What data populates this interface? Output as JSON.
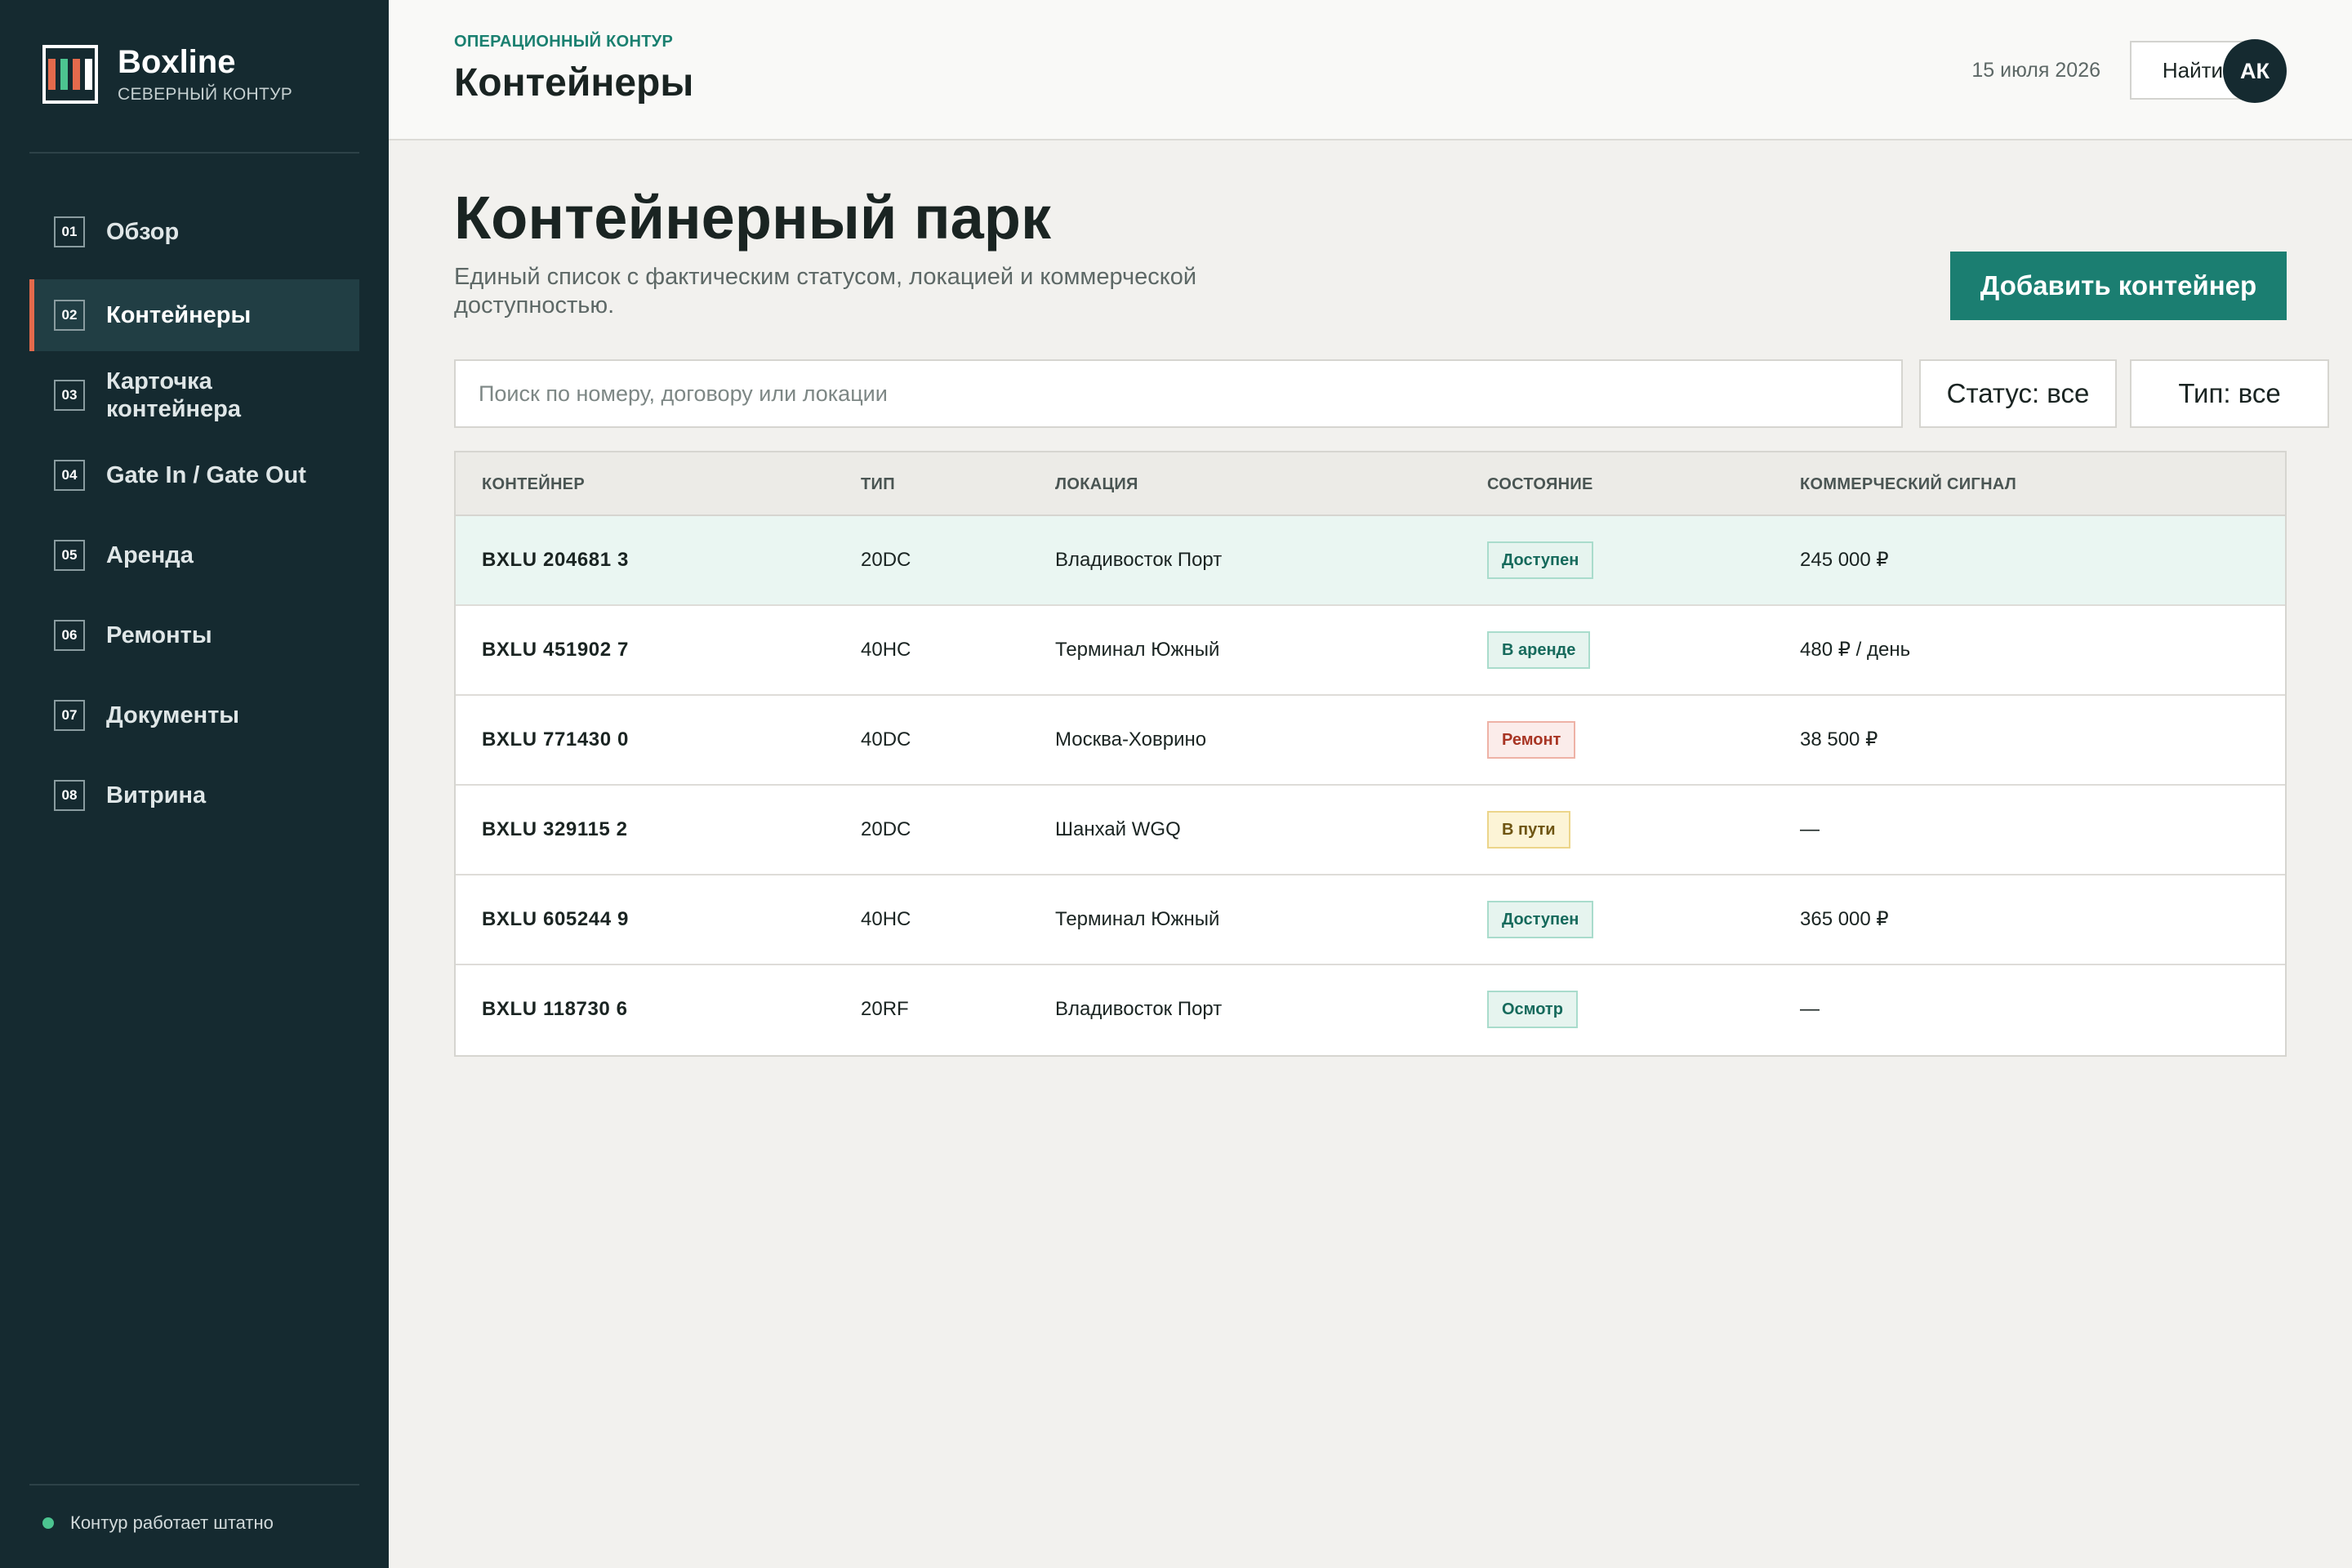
{
  "brand": {
    "name": "Boxline",
    "subtitle": "СЕВЕРНЫЙ КОНТУР"
  },
  "nav": [
    {
      "num": "01",
      "label": "Обзор",
      "active": false
    },
    {
      "num": "02",
      "label": "Контейнеры",
      "active": true
    },
    {
      "num": "03",
      "label": "Карточка контейнера",
      "active": false
    },
    {
      "num": "04",
      "label": "Gate In / Gate Out",
      "active": false
    },
    {
      "num": "05",
      "label": "Аренда",
      "active": false
    },
    {
      "num": "06",
      "label": "Ремонты",
      "active": false
    },
    {
      "num": "07",
      "label": "Документы",
      "active": false
    },
    {
      "num": "08",
      "label": "Витрина",
      "active": false
    }
  ],
  "system_status": "Контур работает штатно",
  "header": {
    "eyebrow": "ОПЕРАЦИОННЫЙ КОНТУР",
    "title": "Контейнеры",
    "date": "15 июля 2026",
    "find_label": "Найти",
    "avatar_initials": "АК"
  },
  "page": {
    "heading": "Контейнерный парк",
    "description": "Единый список с фактическим статусом, локацией и коммерческой доступностью.",
    "add_button": "Добавить контейнер"
  },
  "filters": {
    "search_placeholder": "Поиск по номеру, договору или локации",
    "status": "Статус: все",
    "type": "Тип: все"
  },
  "table": {
    "columns": [
      "КОНТЕЙНЕР",
      "ТИП",
      "ЛОКАЦИЯ",
      "СОСТОЯНИЕ",
      "КОММЕРЧЕСКИЙ СИГНАЛ"
    ],
    "rows": [
      {
        "id": "BXLU 204681 3",
        "type": "20DC",
        "location": "Владивосток Порт",
        "state": "Доступен",
        "signal": "245 000 ₽"
      },
      {
        "id": "BXLU 451902 7",
        "type": "40HC",
        "location": "Терминал Южный",
        "state": "В аренде",
        "signal": "480 ₽ / день"
      },
      {
        "id": "BXLU 771430 0",
        "type": "40DC",
        "location": "Москва-Ховрино",
        "state": "Ремонт",
        "signal": "38 500 ₽"
      },
      {
        "id": "BXLU 329115 2",
        "type": "20DC",
        "location": "Шанхай WGQ",
        "state": "В пути",
        "signal": "—"
      },
      {
        "id": "BXLU 605244 9",
        "type": "40HC",
        "location": "Терминал Южный",
        "state": "Доступен",
        "signal": "365 000 ₽"
      },
      {
        "id": "BXLU 118730 6",
        "type": "20RF",
        "location": "Владивосток Порт",
        "state": "Осмотр",
        "signal": "—"
      }
    ]
  },
  "colors": {
    "sidebar_bg": "#152a30",
    "accent": "#1b7e71",
    "active_marker": "#e46a4c",
    "status_ok": "#4cc490"
  }
}
